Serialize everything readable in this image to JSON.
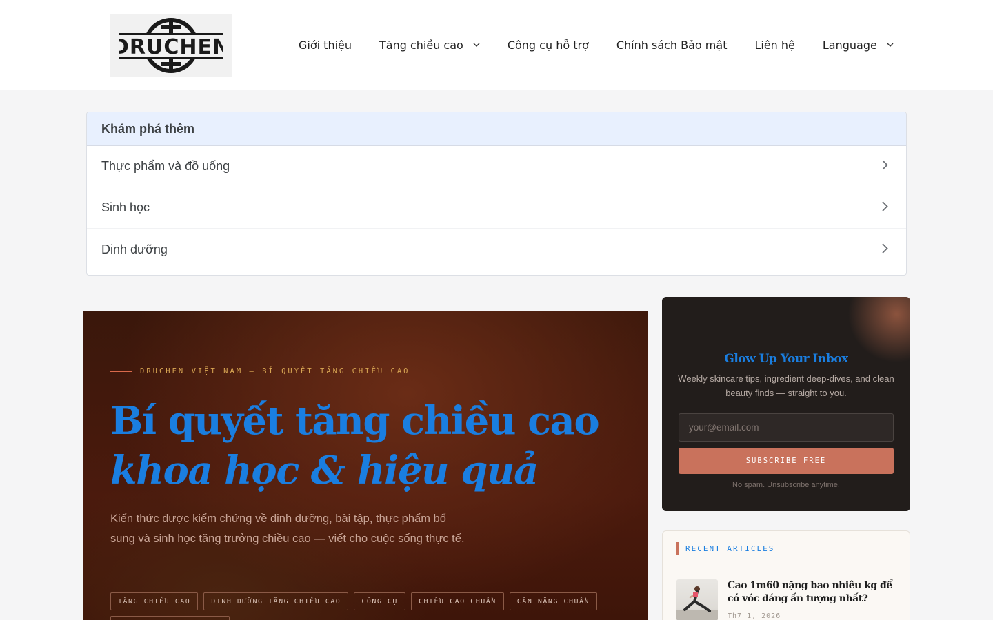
{
  "header": {
    "logo_text": "DRUCHEN",
    "nav": [
      {
        "label": "Giới thiệu",
        "has_dropdown": false
      },
      {
        "label": "Tăng chiều cao",
        "has_dropdown": true
      },
      {
        "label": "Công cụ hỗ trợ",
        "has_dropdown": false
      },
      {
        "label": "Chính sách Bảo mật",
        "has_dropdown": false
      },
      {
        "label": "Liên hệ",
        "has_dropdown": false
      },
      {
        "label": "Language",
        "has_dropdown": true
      }
    ]
  },
  "explore": {
    "title": "Khám phá thêm",
    "items": [
      {
        "label": "Thực phẩm và đồ uống"
      },
      {
        "label": "Sinh học"
      },
      {
        "label": "Dinh dưỡng"
      }
    ]
  },
  "hero": {
    "eyebrow": "DRUCHEN VIỆT NAM — BÍ QUYẾT TĂNG CHIỀU CAO",
    "title_plain": "Bí quyết tăng chiều cao ",
    "title_italic": "khoa học & hiệu quả",
    "description": "Kiến thức được kiểm chứng về dinh dưỡng, bài tập, thực phẩm bổ sung và sinh học tăng trưởng chiều cao — viết cho cuộc sống thực tế.",
    "tags": [
      "TĂNG CHIỀU CAO",
      "DINH DƯỠNG TĂNG CHIỀU CAO",
      "CÔNG CỤ",
      "CHIỀU CAO CHUẨN",
      "CÂN NẶNG CHUẨN"
    ]
  },
  "newsletter": {
    "title": "Glow Up Your Inbox",
    "subtitle": "Weekly skincare tips, ingredient deep-dives, and clean beauty finds — straight to you.",
    "email_placeholder": "your@email.com",
    "button_label": "SUBSCRIBE FREE",
    "note": "No spam. Unsubscribe anytime."
  },
  "recent": {
    "label": "RECENT ARTICLES",
    "articles": [
      {
        "title": "Cao 1m60 nặng bao nhiêu kg để có vóc dáng ấn tượng nhất?",
        "date": "Th7 1, 2026"
      }
    ]
  },
  "colors": {
    "accent_blue": "#1a7ee0",
    "accent_orange": "#c9725c",
    "hero_bg": "#4b1a0d",
    "newsletter_bg": "#221d1b"
  }
}
